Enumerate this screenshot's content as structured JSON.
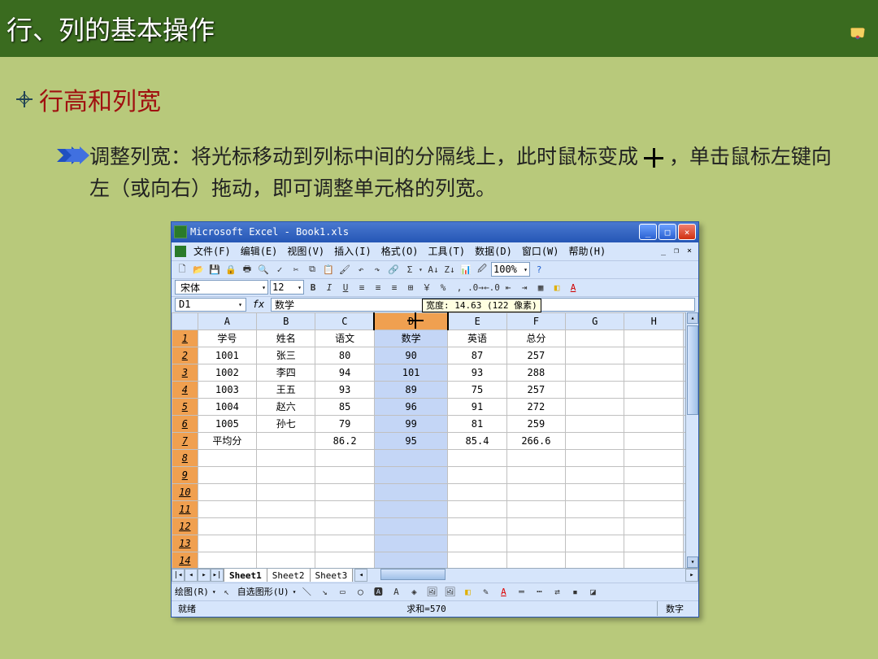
{
  "header": {
    "title": "行、列的基本操作"
  },
  "subhead": {
    "title": "行高和列宽"
  },
  "para": {
    "l1": "调整列宽：将光标移动到列标中间的分隔线上，此时鼠标变成 ",
    "l2": " ，单击鼠标左键向左（或向右）拖动，即可调整单元格的列宽。"
  },
  "excel": {
    "title": "Microsoft Excel - Book1.xls",
    "menus": {
      "file": "文件(F)",
      "edit": "编辑(E)",
      "view": "视图(V)",
      "insert": "插入(I)",
      "format": "格式(O)",
      "tools": "工具(T)",
      "data": "数据(D)",
      "window": "窗口(W)",
      "help": "帮助(H)"
    },
    "font": {
      "name": "宋体",
      "size": "12",
      "zoom": "100%"
    },
    "namebox": "D1",
    "formula": "数学",
    "tooltip": "宽度: 14.63 (122 像素)",
    "cols": [
      "A",
      "B",
      "C",
      "D",
      "E",
      "F",
      "G",
      "H"
    ],
    "rows": [
      {
        "n": "1",
        "c": [
          "学号",
          "姓名",
          "语文",
          "数学",
          "英语",
          "总分",
          "",
          ""
        ]
      },
      {
        "n": "2",
        "c": [
          "1001",
          "张三",
          "80",
          "90",
          "87",
          "257",
          "",
          ""
        ]
      },
      {
        "n": "3",
        "c": [
          "1002",
          "李四",
          "94",
          "101",
          "93",
          "288",
          "",
          ""
        ]
      },
      {
        "n": "4",
        "c": [
          "1003",
          "王五",
          "93",
          "89",
          "75",
          "257",
          "",
          ""
        ]
      },
      {
        "n": "5",
        "c": [
          "1004",
          "赵六",
          "85",
          "96",
          "91",
          "272",
          "",
          ""
        ]
      },
      {
        "n": "6",
        "c": [
          "1005",
          "孙七",
          "79",
          "99",
          "81",
          "259",
          "",
          ""
        ]
      },
      {
        "n": "7",
        "c": [
          "平均分",
          "",
          "86.2",
          "95",
          "85.4",
          "266.6",
          "",
          ""
        ]
      },
      {
        "n": "8",
        "c": [
          "",
          "",
          "",
          "",
          "",
          "",
          "",
          ""
        ]
      },
      {
        "n": "9",
        "c": [
          "",
          "",
          "",
          "",
          "",
          "",
          "",
          ""
        ]
      },
      {
        "n": "10",
        "c": [
          "",
          "",
          "",
          "",
          "",
          "",
          "",
          ""
        ]
      },
      {
        "n": "11",
        "c": [
          "",
          "",
          "",
          "",
          "",
          "",
          "",
          ""
        ]
      },
      {
        "n": "12",
        "c": [
          "",
          "",
          "",
          "",
          "",
          "",
          "",
          ""
        ]
      },
      {
        "n": "13",
        "c": [
          "",
          "",
          "",
          "",
          "",
          "",
          "",
          ""
        ]
      },
      {
        "n": "14",
        "c": [
          "",
          "",
          "",
          "",
          "",
          "",
          "",
          ""
        ]
      }
    ],
    "sheets": [
      "Sheet1",
      "Sheet2",
      "Sheet3"
    ],
    "drawbar": {
      "draw": "绘图(R)",
      "autoshape": "自选图形(U)"
    },
    "status": {
      "ready": "就绪",
      "sum": "求和=570",
      "mode": "数字"
    }
  }
}
